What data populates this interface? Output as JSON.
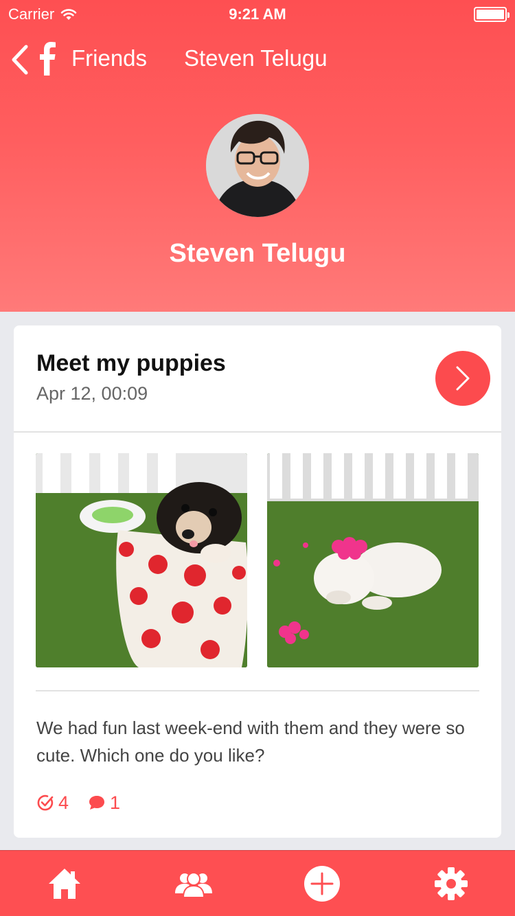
{
  "status_bar": {
    "carrier": "Carrier",
    "time": "9:21 AM",
    "battery_level": 1.0
  },
  "nav": {
    "back_icon": "chevron-left-icon",
    "logo_icon": "facebook-icon",
    "friends_label": "Friends",
    "title": "Steven Telugu"
  },
  "profile": {
    "name": "Steven Telugu"
  },
  "post": {
    "title": "Meet my puppies",
    "date": "Apr 12, 00:09",
    "body": "We had fun last week-end with them and they were so cute. Which one do you like?",
    "likes": "4",
    "comments": "1"
  },
  "tabbar": {
    "items": [
      {
        "icon": "home-icon"
      },
      {
        "icon": "friends-icon"
      },
      {
        "icon": "add-icon"
      },
      {
        "icon": "settings-icon"
      }
    ]
  },
  "colors": {
    "accent": "#fc4b4e",
    "header_top": "#fe4f52",
    "header_bottom": "#ff7a79",
    "background": "#e9eaee"
  }
}
